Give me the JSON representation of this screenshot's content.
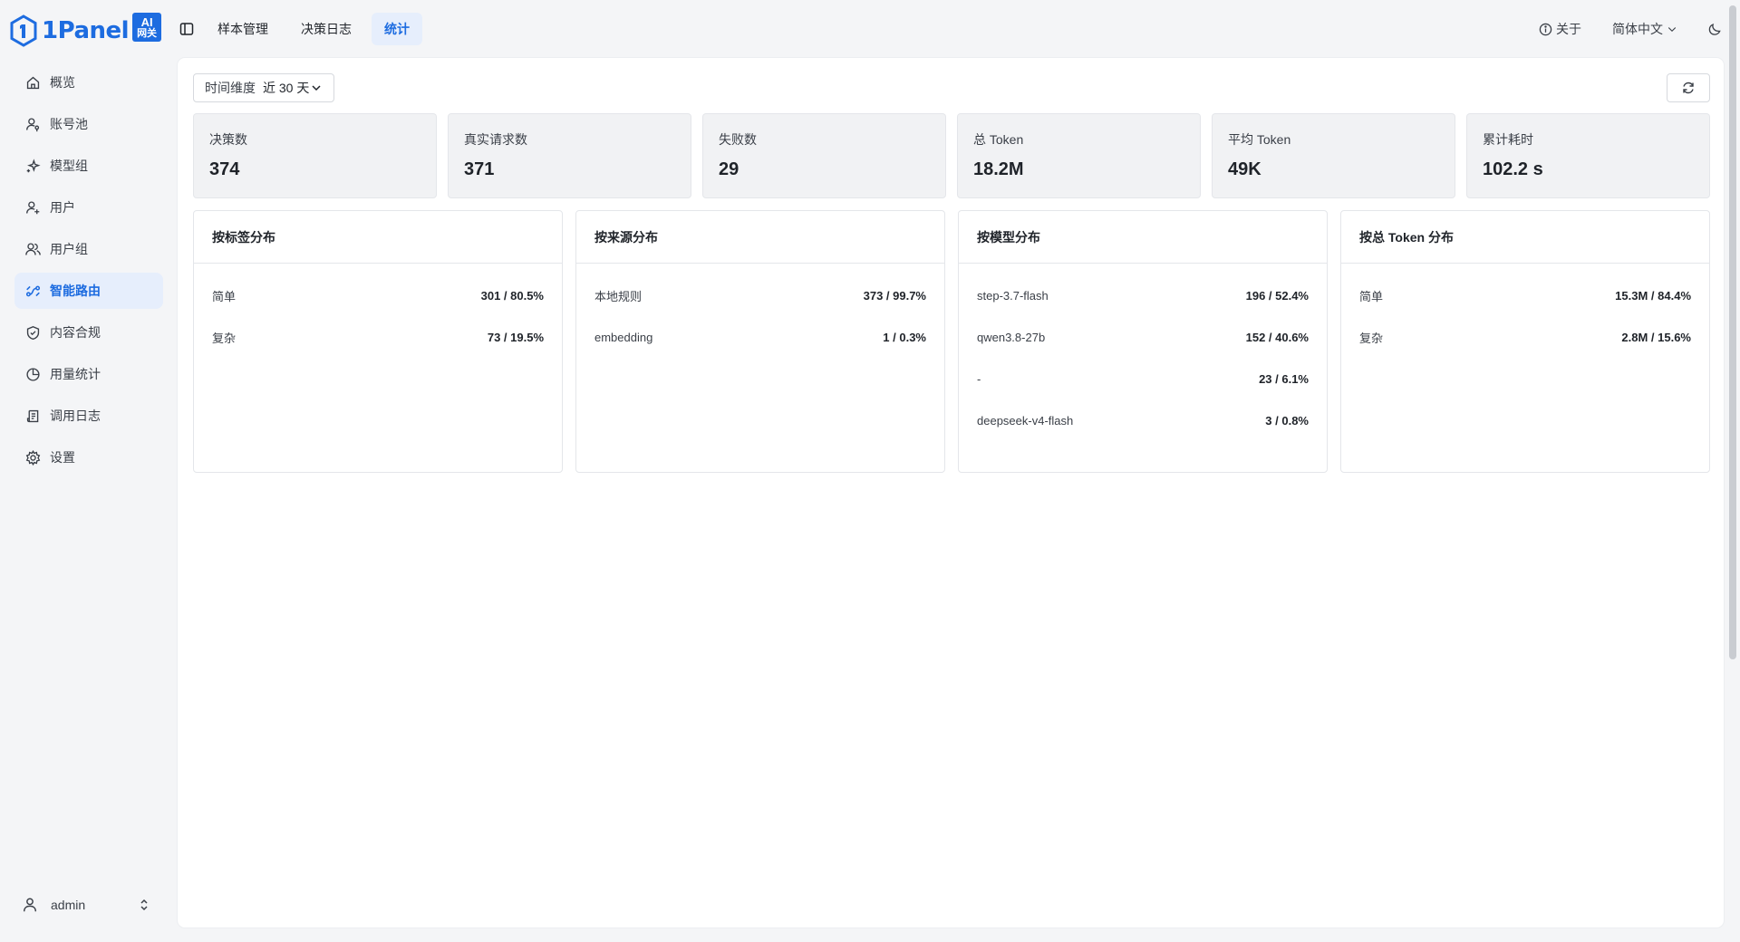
{
  "brand": {
    "name": "1Panel",
    "badge_top": "AI",
    "badge_bottom": "网关"
  },
  "sidebar": {
    "items": [
      {
        "label": "概览",
        "icon": "home-icon"
      },
      {
        "label": "账号池",
        "icon": "user-key-icon"
      },
      {
        "label": "模型组",
        "icon": "sparkle-icon"
      },
      {
        "label": "用户",
        "icon": "user-add-icon"
      },
      {
        "label": "用户组",
        "icon": "users-icon"
      },
      {
        "label": "智能路由",
        "icon": "route-icon",
        "active": true
      },
      {
        "label": "内容合规",
        "icon": "shield-check-icon"
      },
      {
        "label": "用量统计",
        "icon": "pie-chart-icon"
      },
      {
        "label": "调用日志",
        "icon": "log-icon"
      },
      {
        "label": "设置",
        "icon": "gear-icon"
      }
    ],
    "user": "admin"
  },
  "topbar": {
    "tabs": [
      {
        "label": "样本管理"
      },
      {
        "label": "决策日志"
      },
      {
        "label": "统计",
        "active": true
      }
    ],
    "about": "关于",
    "language": "简体中文"
  },
  "filter": {
    "label": "时间维度",
    "value": "近 30 天"
  },
  "stats": [
    {
      "label": "决策数",
      "value": "374"
    },
    {
      "label": "真实请求数",
      "value": "371"
    },
    {
      "label": "失败数",
      "value": "29"
    },
    {
      "label": "总 Token",
      "value": "18.2M"
    },
    {
      "label": "平均 Token",
      "value": "49K"
    },
    {
      "label": "累计耗时",
      "value": "102.2 s"
    }
  ],
  "distributions": [
    {
      "title": "按标签分布",
      "rows": [
        {
          "name": "简单",
          "value": "301 / 80.5%"
        },
        {
          "name": "复杂",
          "value": "73 / 19.5%"
        }
      ]
    },
    {
      "title": "按来源分布",
      "rows": [
        {
          "name": "本地规则",
          "value": "373 / 99.7%"
        },
        {
          "name": "embedding",
          "value": "1 / 0.3%"
        }
      ]
    },
    {
      "title": "按模型分布",
      "rows": [
        {
          "name": "step-3.7-flash",
          "value": "196 / 52.4%"
        },
        {
          "name": "qwen3.8-27b",
          "value": "152 / 40.6%"
        },
        {
          "name": "-",
          "value": "23 / 6.1%"
        },
        {
          "name": "deepseek-v4-flash",
          "value": "3 / 0.8%"
        }
      ]
    },
    {
      "title": "按总 Token 分布",
      "rows": [
        {
          "name": "简单",
          "value": "15.3M / 84.4%"
        },
        {
          "name": "复杂",
          "value": "2.8M / 15.6%"
        }
      ]
    }
  ],
  "colors": {
    "accent": "#1d6ce0",
    "active_bg": "#e6eefc",
    "page_bg": "#f4f5f7"
  }
}
